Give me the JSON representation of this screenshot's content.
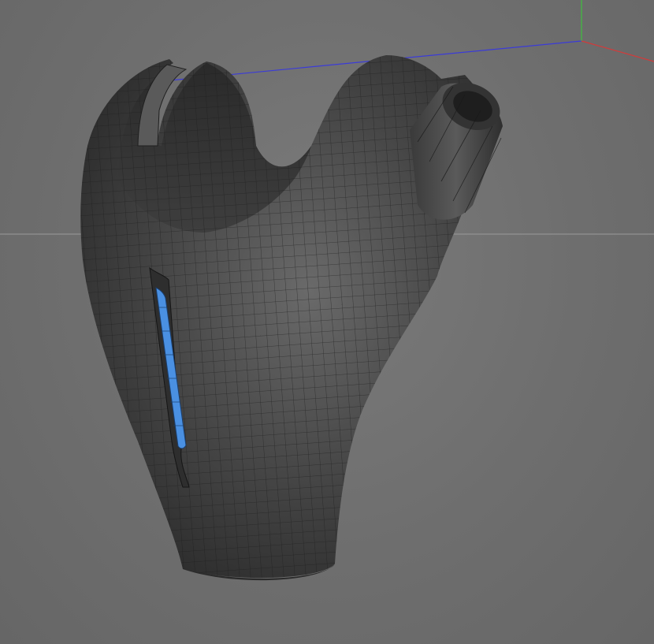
{
  "viewport": {
    "background": "#6f6f6f",
    "grid_visible": true,
    "axis_gizmo": {
      "x_axis_color": "#d23b3b",
      "y_axis_color": "#3fbf3f",
      "z_axis_color": "#3b3bd8"
    }
  },
  "model": {
    "display_mode": "gouraud-shaded-wireframe",
    "base_color": "#3c3c3c",
    "wire_color": "#1a1a1a",
    "highlight_color": "#4a90e2"
  }
}
